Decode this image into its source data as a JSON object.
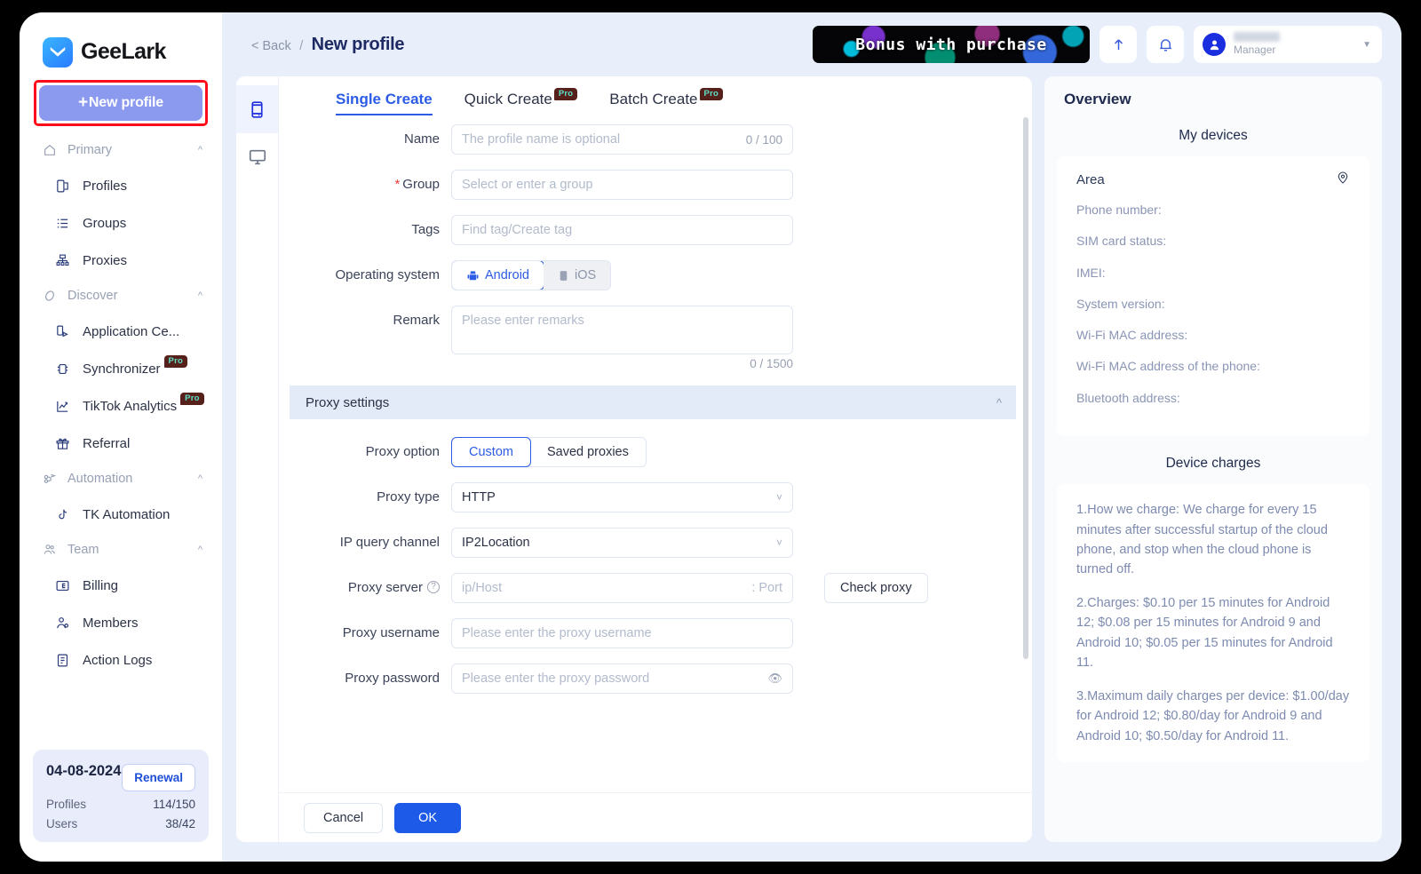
{
  "brand": {
    "name": "GeeLark"
  },
  "sidebar": {
    "new_profile_label": "New profile",
    "new_profile_plus": "+",
    "groups": [
      {
        "label": "Primary",
        "icon": "home-icon",
        "items": [
          {
            "label": "Profiles",
            "icon": "profiles-icon",
            "pro": false
          },
          {
            "label": "Groups",
            "icon": "groups-icon",
            "pro": false
          },
          {
            "label": "Proxies",
            "icon": "proxies-icon",
            "pro": false
          }
        ]
      },
      {
        "label": "Discover",
        "icon": "compass-icon",
        "items": [
          {
            "label": "Application Ce...",
            "icon": "application-center-icon",
            "pro": false
          },
          {
            "label": "Synchronizer",
            "icon": "synchronizer-icon",
            "pro": true
          },
          {
            "label": "TikTok Analytics",
            "icon": "analytics-icon",
            "pro": true
          },
          {
            "label": "Referral",
            "icon": "gift-icon",
            "pro": false
          }
        ]
      },
      {
        "label": "Automation",
        "icon": "automation-icon",
        "items": [
          {
            "label": "TK Automation",
            "icon": "tiktok-icon",
            "pro": false
          }
        ]
      },
      {
        "label": "Team",
        "icon": "team-icon",
        "items": [
          {
            "label": "Billing",
            "icon": "billing-icon",
            "pro": false
          },
          {
            "label": "Members",
            "icon": "members-icon",
            "pro": false
          },
          {
            "label": "Action Logs",
            "icon": "action-logs-icon",
            "pro": false
          }
        ]
      }
    ],
    "pro_badge": "Pro",
    "plan": {
      "date": "04-08-2024",
      "renewal_label": "Renewal",
      "rows": [
        {
          "label": "Profiles",
          "value": "114/150"
        },
        {
          "label": "Users",
          "value": "38/42"
        }
      ]
    }
  },
  "topbar": {
    "back_label": "< Back",
    "separator": "/",
    "title": "New profile",
    "promo_text": "Bonus with purchase",
    "user_role": "Manager"
  },
  "device_rail": [
    {
      "icon": "phone-icon",
      "active": true
    },
    {
      "icon": "desktop-icon",
      "active": false
    }
  ],
  "form": {
    "tabs": [
      {
        "label": "Single Create",
        "active": true,
        "pro": false
      },
      {
        "label": "Quick Create",
        "active": false,
        "pro": true
      },
      {
        "label": "Batch Create",
        "active": false,
        "pro": true
      }
    ],
    "pro_badge": "Pro",
    "name": {
      "label": "Name",
      "placeholder": "The profile name is optional",
      "value": "",
      "counter": "0 / 100"
    },
    "group": {
      "label": "Group",
      "placeholder": "Select or enter a group",
      "value": "",
      "required": true
    },
    "tags": {
      "label": "Tags",
      "placeholder": "Find tag/Create tag",
      "value": ""
    },
    "os": {
      "label": "Operating system",
      "options": [
        {
          "label": "Android",
          "icon": "android-icon",
          "active": true
        },
        {
          "label": "iOS",
          "icon": "apple-icon",
          "active": false
        }
      ]
    },
    "remark": {
      "label": "Remark",
      "placeholder": "Please enter remarks",
      "value": "",
      "counter": "0 / 1500"
    },
    "proxy_section": {
      "title": "Proxy settings",
      "collapsed": false
    },
    "proxy_option": {
      "label": "Proxy option",
      "options": [
        {
          "label": "Custom",
          "active": true
        },
        {
          "label": "Saved proxies",
          "active": false
        }
      ]
    },
    "proxy_type": {
      "label": "Proxy type",
      "value": "HTTP"
    },
    "ip_query_channel": {
      "label": "IP query channel",
      "value": "IP2Location"
    },
    "proxy_server": {
      "label": "Proxy server",
      "host_placeholder": "ip/Host",
      "port_placeholder": ": Port",
      "value": "",
      "check_button": "Check proxy"
    },
    "proxy_username": {
      "label": "Proxy username",
      "placeholder": "Please enter the proxy username",
      "value": ""
    },
    "proxy_password": {
      "label": "Proxy password",
      "placeholder": "Please enter the proxy password",
      "value": ""
    },
    "footer": {
      "cancel": "Cancel",
      "ok": "OK"
    }
  },
  "overview": {
    "title": "Overview",
    "devices": {
      "section_title": "My devices",
      "area_label": "Area",
      "fields": [
        "Phone number:",
        "SIM card status:",
        "IMEI:",
        "System version:",
        "Wi-Fi MAC address:",
        "Wi-Fi MAC address of the phone:",
        "Bluetooth address:"
      ]
    },
    "charges": {
      "section_title": "Device charges",
      "paragraphs": [
        "1.How we charge: We charge for every 15 minutes after successful startup of the cloud phone, and stop when the cloud phone is turned off.",
        "2.Charges: $0.10 per 15 minutes for Android 12; $0.08 per 15 minutes for Android 9 and Android 10; $0.05 per 15 minutes for Android 11.",
        "3.Maximum daily charges per device: $1.00/day for Android 12; $0.80/day for Android 9 and Android 10; $0.50/day for Android 11."
      ]
    }
  },
  "colors": {
    "accent": "#2c5ce6",
    "primary_button": "#1d5ae8",
    "new_profile_button": "#8b99ef",
    "highlight_box": "#fc0d1c",
    "page_background": "#e8eefa",
    "pro_badge_bg": "#55211a",
    "pro_badge_text": "#5ee0c8"
  }
}
